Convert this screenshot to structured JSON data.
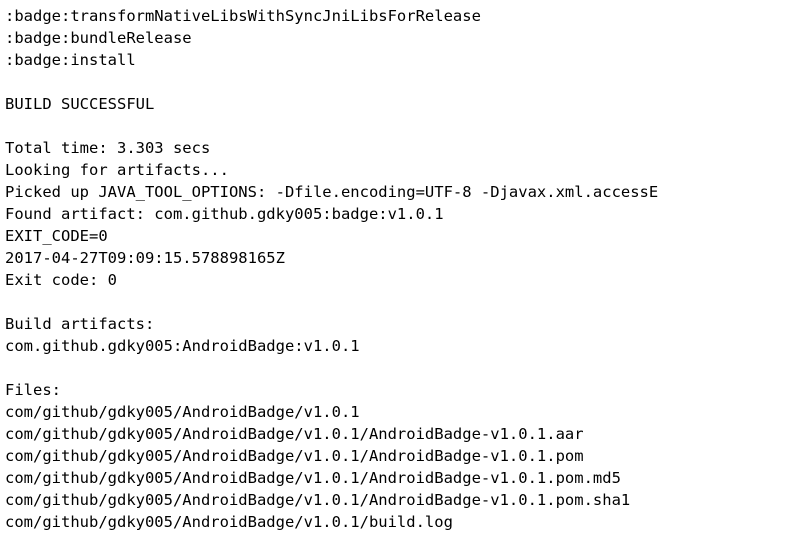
{
  "console": {
    "lines": [
      ":badge:transformNativeLibsWithSyncJniLibsForRelease",
      ":badge:bundleRelease",
      ":badge:install",
      "",
      "BUILD SUCCESSFUL",
      "",
      "Total time: 3.303 secs",
      "Looking for artifacts...",
      "Picked up JAVA_TOOL_OPTIONS: -Dfile.encoding=UTF-8 -Djavax.xml.accessE",
      "Found artifact: com.github.gdky005:badge:v1.0.1",
      "EXIT_CODE=0",
      "2017-04-27T09:09:15.578898165Z",
      "Exit code: 0",
      "",
      "Build artifacts:",
      "com.github.gdky005:AndroidBadge:v1.0.1",
      "",
      "Files:",
      "com/github/gdky005/AndroidBadge/v1.0.1",
      "com/github/gdky005/AndroidBadge/v1.0.1/AndroidBadge-v1.0.1.aar",
      "com/github/gdky005/AndroidBadge/v1.0.1/AndroidBadge-v1.0.1.pom",
      "com/github/gdky005/AndroidBadge/v1.0.1/AndroidBadge-v1.0.1.pom.md5",
      "com/github/gdky005/AndroidBadge/v1.0.1/AndroidBadge-v1.0.1.pom.sha1",
      "com/github/gdky005/AndroidBadge/v1.0.1/build.log"
    ]
  }
}
